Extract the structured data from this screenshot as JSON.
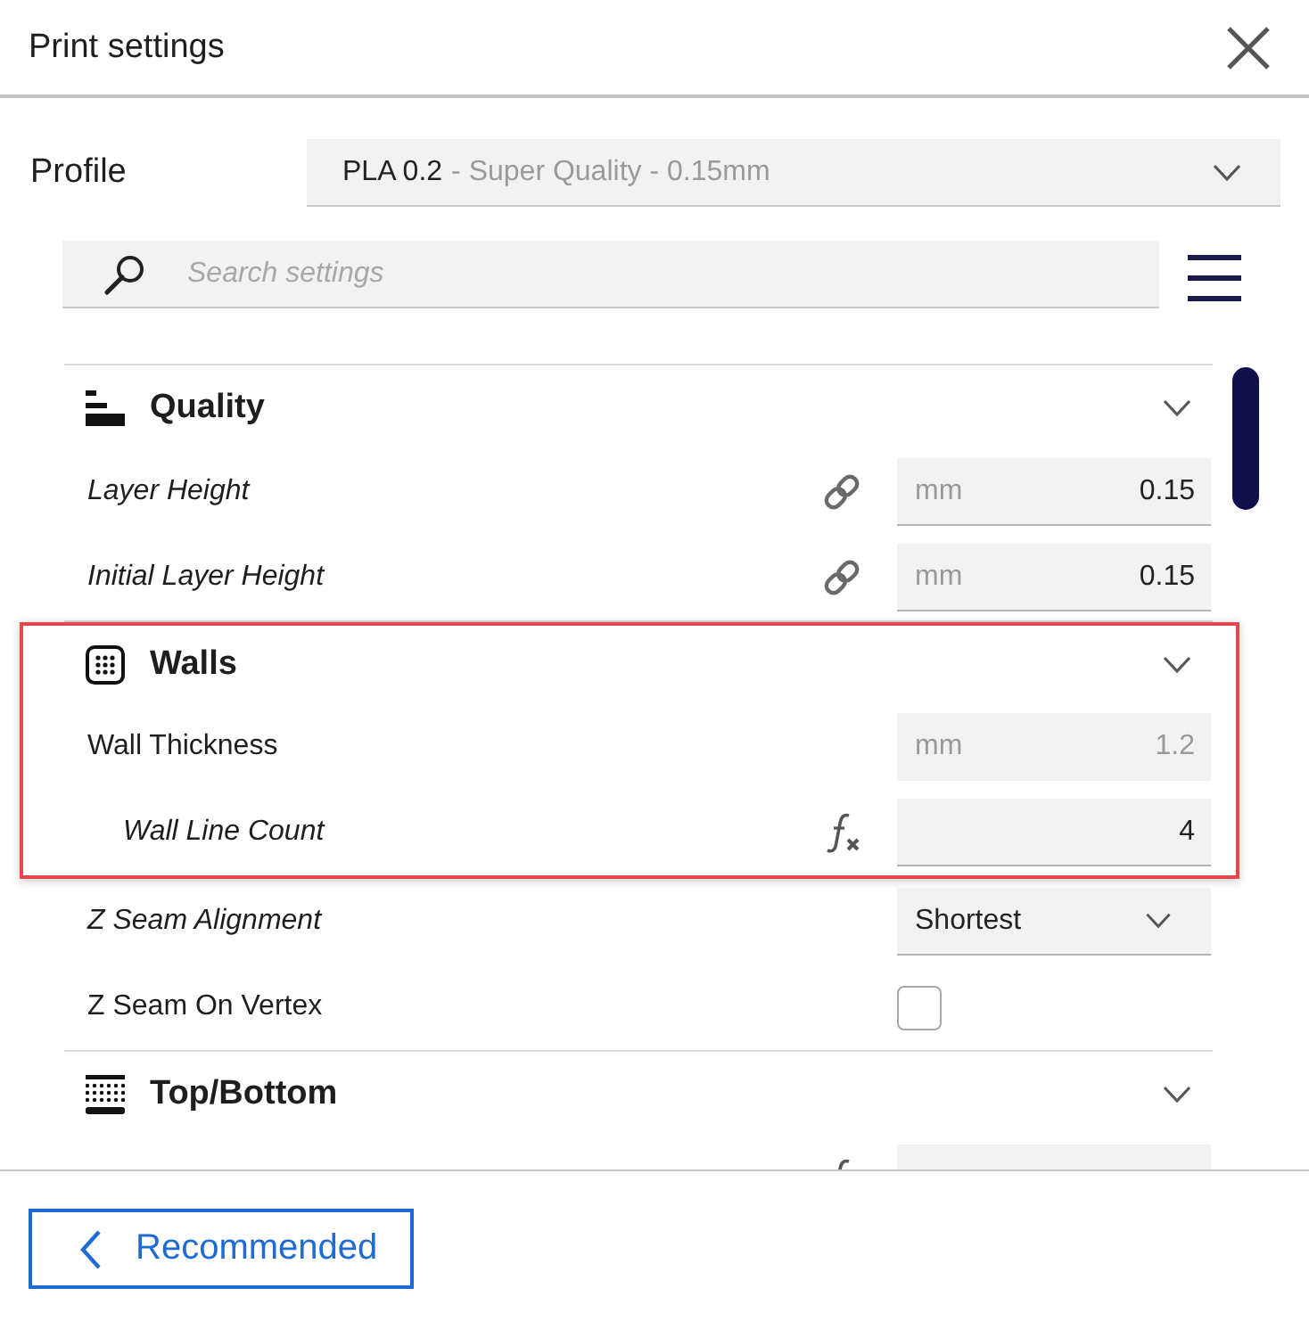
{
  "window": {
    "title": "Print settings"
  },
  "profile": {
    "label": "Profile",
    "value": "PLA 0.2",
    "detail": "- Super Quality - 0.15mm"
  },
  "search": {
    "placeholder": "Search settings"
  },
  "sections": [
    {
      "title": "Quality",
      "kind": "quality",
      "expanded": true,
      "highlighted": false,
      "rows": [
        {
          "label": "Layer Height",
          "kind": "number",
          "modified": true,
          "indicator": {
            "kind": "link"
          },
          "unit": "mm",
          "value": "0.15",
          "disabled": false
        },
        {
          "label": "Initial Layer Height",
          "kind": "number",
          "modified": true,
          "indicator": {
            "kind": "link"
          },
          "unit": "mm",
          "value": "0.15",
          "disabled": false
        }
      ]
    },
    {
      "title": "Walls",
      "kind": "walls",
      "expanded": true,
      "highlighted": true,
      "rows": [
        {
          "label": "Wall Thickness",
          "kind": "number",
          "modified": false,
          "unit": "mm",
          "value": "1.2",
          "disabled": true,
          "highlighted": true,
          "children": [
            {
              "label": "Wall Line Count",
              "kind": "number",
              "modified": true,
              "indicator": {
                "kind": "formula"
              },
              "value": "4",
              "disabled": false
            }
          ]
        },
        {
          "label": "Z Seam Alignment",
          "kind": "select",
          "modified": true,
          "value": "Shortest",
          "highlighted": false
        },
        {
          "label": "Z Seam On Vertex",
          "kind": "checkbox",
          "modified": false,
          "checked": false,
          "highlighted": false
        }
      ]
    },
    {
      "title": "Top/Bottom",
      "kind": "top_bottom",
      "expanded": true,
      "highlighted": false,
      "rows": [
        {
          "kind": "number",
          "indicator": {
            "kind": "formula"
          },
          "disabled": false
        }
      ]
    }
  ],
  "footer": {
    "button": "Recommended"
  }
}
